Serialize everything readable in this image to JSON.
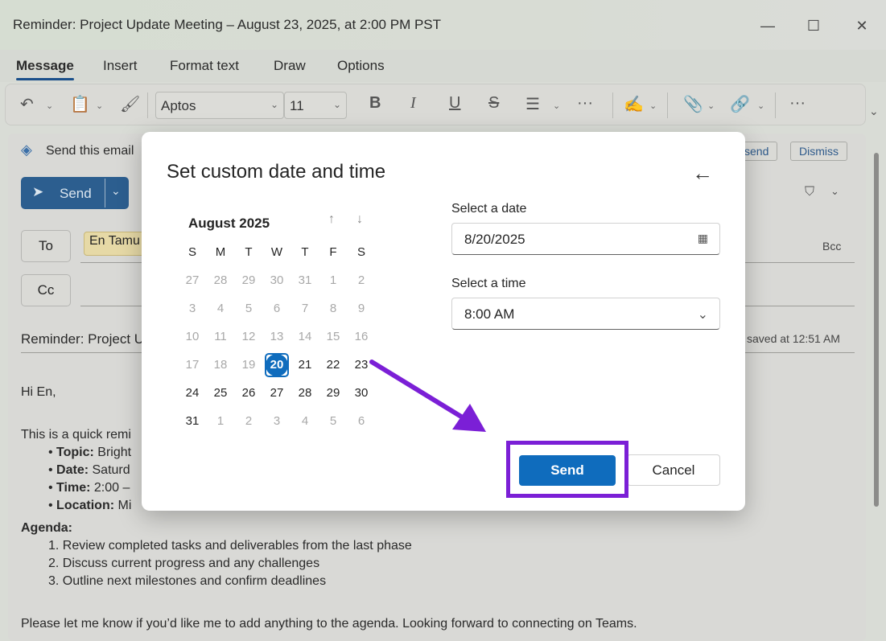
{
  "window": {
    "title": "Reminder: Project Update Meeting – August 23, 2025, at 2:00 PM PST",
    "minimize": "—",
    "maximize": "☐",
    "close": "✕"
  },
  "ribbon": {
    "tabs": [
      "Message",
      "Insert",
      "Format text",
      "Draw",
      "Options"
    ],
    "font": "Aptos",
    "font_size": "11",
    "bold": "B",
    "italic": "I",
    "underline": "U",
    "strike": "S",
    "more": "···"
  },
  "banner": {
    "text": "Send this email",
    "action": "send",
    "dismiss": "Dismiss"
  },
  "compose": {
    "send_label": "Send",
    "to_label": "To",
    "cc_label": "Cc",
    "bcc_label": "Bcc",
    "to_recipient": "En Tamu",
    "subject": "Reminder: Project U",
    "saved": "saved at 12:51 AM",
    "body": {
      "greeting": "Hi En,",
      "intro": "This is a quick remi",
      "bullets": [
        {
          "key": "Topic:",
          "value": " Bright"
        },
        {
          "key": "Date:",
          "value": " Saturd"
        },
        {
          "key": "Time:",
          "value": " 2:00 –"
        },
        {
          "key": "Location:",
          "value": " Mi"
        }
      ],
      "agenda_title": "Agenda:",
      "agenda": [
        "1. Review completed tasks and deliverables from the last phase",
        "2. Discuss current progress and any challenges",
        "3. Outline next milestones and confirm deadlines"
      ],
      "closing": "Please let me know if you’d like me to add anything to the agenda. Looking forward to connecting on Teams."
    }
  },
  "dialog": {
    "title": "Set custom date and time",
    "month": "August 2025",
    "weekdays": [
      "S",
      "M",
      "T",
      "W",
      "T",
      "F",
      "S"
    ],
    "days": [
      [
        "27",
        "28",
        "29",
        "30",
        "31",
        "1",
        "2"
      ],
      [
        "3",
        "4",
        "5",
        "6",
        "7",
        "8",
        "9"
      ],
      [
        "10",
        "11",
        "12",
        "13",
        "14",
        "15",
        "16"
      ],
      [
        "17",
        "18",
        "19",
        "20",
        "21",
        "22",
        "23"
      ],
      [
        "24",
        "25",
        "26",
        "27",
        "28",
        "29",
        "30"
      ],
      [
        "31",
        "1",
        "2",
        "3",
        "4",
        "5",
        "6"
      ]
    ],
    "selected_day": "20",
    "date_label": "Select a date",
    "date_value": "8/20/2025",
    "time_label": "Select a time",
    "time_value": "8:00 AM",
    "send_button": "Send",
    "cancel_button": "Cancel"
  },
  "colors": {
    "accent": "#0f6cbd",
    "annotation": "#7b1fd6"
  }
}
